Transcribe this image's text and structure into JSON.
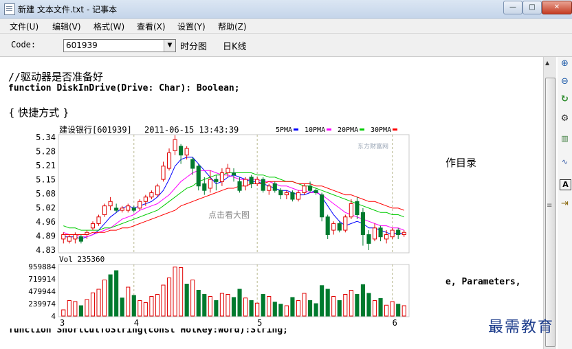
{
  "window": {
    "title": "新建 文本文件.txt - 记事本",
    "minimize": "—",
    "maximize": "□",
    "close": "✕"
  },
  "menu": [
    "文件(U)",
    "编辑(V)",
    "格式(W)",
    "查看(X)",
    "设置(Y)",
    "帮助(Z)"
  ],
  "toolbar": {
    "code_label": "Code:",
    "code_value": "601939",
    "time_chart": "时分图",
    "daily_k": "日K线"
  },
  "editor": {
    "comment": "//驱动器是否准备好",
    "func1": "function DiskInDrive(Drive: Char): Boolean;",
    "section": "{ 快捷方式 }",
    "partial_right": "作目录",
    "params": "e, Parameters,",
    "func2": "function ShortCutToString(const HotKey:Word):String;"
  },
  "right_icons": [
    "zoom-in-icon",
    "zoom-out-icon",
    "refresh-icon",
    "settings-icon",
    "bar-chart-icon",
    "line-chart-icon",
    "text-icon",
    "exit-icon"
  ],
  "watermark": "最需教育",
  "chart_data": {
    "type": "candlestick",
    "title": "建设银行[601939]",
    "timestamp": "2011-06-15 13:43:39",
    "center_label": "点击看大图",
    "source_logo": "东方财富网",
    "legend": [
      {
        "name": "5PMA",
        "color": "#0000ff"
      },
      {
        "name": "10PMA",
        "color": "#ff00ff"
      },
      {
        "name": "20PMA",
        "color": "#00cc00"
      },
      {
        "name": "30PMA",
        "color": "#ff0000"
      }
    ],
    "price_ticks": [
      "5.34",
      "5.28",
      "5.21",
      "5.15",
      "5.08",
      "5.02",
      "4.96",
      "4.89",
      "4.83"
    ],
    "price_range": [
      4.83,
      5.34
    ],
    "volume_label": "Vol 235360",
    "volume_ticks": [
      "959884",
      "719914",
      "479944",
      "239974",
      "4"
    ],
    "volume_max": 959884,
    "x_ticks": [
      "3",
      "4",
      "5",
      "6"
    ],
    "candles": [
      {
        "o": 4.88,
        "c": 4.9,
        "h": 4.91,
        "l": 4.86
      },
      {
        "o": 4.87,
        "c": 4.89,
        "h": 4.9,
        "l": 4.86
      },
      {
        "o": 4.88,
        "c": 4.9,
        "h": 4.91,
        "l": 4.86
      },
      {
        "o": 4.89,
        "c": 4.87,
        "h": 4.9,
        "l": 4.86
      },
      {
        "o": 4.9,
        "c": 4.91,
        "h": 4.92,
        "l": 4.88
      },
      {
        "o": 4.93,
        "c": 4.95,
        "h": 4.96,
        "l": 4.92
      },
      {
        "o": 4.95,
        "c": 4.98,
        "h": 4.99,
        "l": 4.94
      },
      {
        "o": 4.99,
        "c": 5.03,
        "h": 5.04,
        "l": 4.98
      },
      {
        "o": 5.03,
        "c": 5.05,
        "h": 5.07,
        "l": 5.01
      },
      {
        "o": 5.02,
        "c": 5.01,
        "h": 5.04,
        "l": 5.0
      },
      {
        "o": 5.01,
        "c": 5.02,
        "h": 5.03,
        "l": 5.0
      },
      {
        "o": 5.01,
        "c": 5.03,
        "h": 5.04,
        "l": 5.0
      },
      {
        "o": 5.02,
        "c": 5.01,
        "h": 5.03,
        "l": 5.0
      },
      {
        "o": 5.02,
        "c": 5.05,
        "h": 5.06,
        "l": 5.01
      },
      {
        "o": 5.05,
        "c": 5.07,
        "h": 5.08,
        "l": 5.03
      },
      {
        "o": 5.07,
        "c": 5.09,
        "h": 5.1,
        "l": 5.06
      },
      {
        "o": 5.08,
        "c": 5.12,
        "h": 5.13,
        "l": 5.07
      },
      {
        "o": 5.15,
        "c": 5.21,
        "h": 5.23,
        "l": 5.14
      },
      {
        "o": 5.2,
        "c": 5.27,
        "h": 5.29,
        "l": 5.19
      },
      {
        "o": 5.28,
        "c": 5.33,
        "h": 5.35,
        "l": 5.26
      },
      {
        "o": 5.3,
        "c": 5.26,
        "h": 5.31,
        "l": 5.22
      },
      {
        "o": 5.26,
        "c": 5.29,
        "h": 5.3,
        "l": 5.24
      },
      {
        "o": 5.24,
        "c": 5.2,
        "h": 5.25,
        "l": 5.17
      },
      {
        "o": 5.21,
        "c": 5.12,
        "h": 5.22,
        "l": 5.1
      },
      {
        "o": 5.13,
        "c": 5.1,
        "h": 5.16,
        "l": 5.08
      },
      {
        "o": 5.11,
        "c": 5.15,
        "h": 5.19,
        "l": 5.09
      },
      {
        "o": 5.15,
        "c": 5.14,
        "h": 5.17,
        "l": 5.1
      },
      {
        "o": 5.14,
        "c": 5.18,
        "h": 5.2,
        "l": 5.12
      },
      {
        "o": 5.18,
        "c": 5.2,
        "h": 5.22,
        "l": 5.16
      },
      {
        "o": 5.18,
        "c": 5.17,
        "h": 5.2,
        "l": 5.14
      },
      {
        "o": 5.14,
        "c": 5.1,
        "h": 5.16,
        "l": 5.09
      },
      {
        "o": 5.12,
        "c": 5.15,
        "h": 5.16,
        "l": 5.1
      },
      {
        "o": 5.16,
        "c": 5.13,
        "h": 5.17,
        "l": 5.11
      },
      {
        "o": 5.13,
        "c": 5.15,
        "h": 5.16,
        "l": 5.12
      },
      {
        "o": 5.15,
        "c": 5.1,
        "h": 5.16,
        "l": 5.09
      },
      {
        "o": 5.1,
        "c": 5.12,
        "h": 5.13,
        "l": 5.08
      },
      {
        "o": 5.13,
        "c": 5.1,
        "h": 5.14,
        "l": 5.09
      },
      {
        "o": 5.1,
        "c": 5.08,
        "h": 5.11,
        "l": 5.06
      },
      {
        "o": 5.08,
        "c": 5.09,
        "h": 5.1,
        "l": 5.06
      },
      {
        "o": 5.09,
        "c": 5.06,
        "h": 5.1,
        "l": 5.05
      },
      {
        "o": 5.06,
        "c": 5.09,
        "h": 5.1,
        "l": 5.05
      },
      {
        "o": 5.09,
        "c": 5.12,
        "h": 5.13,
        "l": 5.08
      },
      {
        "o": 5.12,
        "c": 5.1,
        "h": 5.14,
        "l": 5.09
      },
      {
        "o": 5.1,
        "c": 5.09,
        "h": 5.11,
        "l": 5.08
      },
      {
        "o": 5.08,
        "c": 4.98,
        "h": 5.09,
        "l": 4.96
      },
      {
        "o": 4.98,
        "c": 4.9,
        "h": 4.99,
        "l": 4.88
      },
      {
        "o": 4.92,
        "c": 4.95,
        "h": 4.96,
        "l": 4.9
      },
      {
        "o": 4.95,
        "c": 4.92,
        "h": 4.96,
        "l": 4.91
      },
      {
        "o": 4.92,
        "c": 4.98,
        "h": 4.99,
        "l": 4.91
      },
      {
        "o": 4.98,
        "c": 5.04,
        "h": 5.06,
        "l": 4.97
      },
      {
        "o": 5.05,
        "c": 4.99,
        "h": 5.07,
        "l": 4.97
      },
      {
        "o": 5.0,
        "c": 4.9,
        "h": 5.02,
        "l": 4.85
      },
      {
        "o": 4.9,
        "c": 4.86,
        "h": 4.92,
        "l": 4.83
      },
      {
        "o": 4.88,
        "c": 4.93,
        "h": 4.95,
        "l": 4.87
      },
      {
        "o": 4.93,
        "c": 4.89,
        "h": 4.94,
        "l": 4.87
      },
      {
        "o": 4.88,
        "c": 4.9,
        "h": 4.92,
        "l": 4.86
      },
      {
        "o": 4.89,
        "c": 4.92,
        "h": 4.93,
        "l": 4.88
      },
      {
        "o": 4.92,
        "c": 4.9,
        "h": 4.93,
        "l": 4.88
      },
      {
        "o": 4.9,
        "c": 4.91,
        "h": 4.92,
        "l": 4.89
      }
    ],
    "volumes": [
      [
        120000,
        "up"
      ],
      [
        300000,
        "up"
      ],
      [
        280000,
        "up"
      ],
      [
        200000,
        "down"
      ],
      [
        320000,
        "up"
      ],
      [
        450000,
        "up"
      ],
      [
        520000,
        "up"
      ],
      [
        700000,
        "up"
      ],
      [
        800000,
        "down"
      ],
      [
        880000,
        "down"
      ],
      [
        350000,
        "down"
      ],
      [
        560000,
        "up"
      ],
      [
        400000,
        "down"
      ],
      [
        300000,
        "up"
      ],
      [
        260000,
        "up"
      ],
      [
        380000,
        "up"
      ],
      [
        420000,
        "up"
      ],
      [
        600000,
        "up"
      ],
      [
        740000,
        "up"
      ],
      [
        950000,
        "up"
      ],
      [
        940000,
        "up"
      ],
      [
        620000,
        "down"
      ],
      [
        700000,
        "up"
      ],
      [
        500000,
        "down"
      ],
      [
        420000,
        "down"
      ],
      [
        380000,
        "up"
      ],
      [
        300000,
        "down"
      ],
      [
        440000,
        "up"
      ],
      [
        420000,
        "up"
      ],
      [
        360000,
        "down"
      ],
      [
        520000,
        "down"
      ],
      [
        350000,
        "up"
      ],
      [
        300000,
        "down"
      ],
      [
        250000,
        "up"
      ],
      [
        420000,
        "down"
      ],
      [
        380000,
        "up"
      ],
      [
        270000,
        "down"
      ],
      [
        230000,
        "down"
      ],
      [
        200000,
        "up"
      ],
      [
        360000,
        "down"
      ],
      [
        300000,
        "up"
      ],
      [
        440000,
        "up"
      ],
      [
        300000,
        "down"
      ],
      [
        240000,
        "down"
      ],
      [
        590000,
        "down"
      ],
      [
        520000,
        "down"
      ],
      [
        380000,
        "up"
      ],
      [
        300000,
        "down"
      ],
      [
        420000,
        "up"
      ],
      [
        500000,
        "up"
      ],
      [
        420000,
        "down"
      ],
      [
        610000,
        "down"
      ],
      [
        440000,
        "down"
      ],
      [
        300000,
        "up"
      ],
      [
        340000,
        "down"
      ],
      [
        210000,
        "up"
      ],
      [
        280000,
        "up"
      ],
      [
        230000,
        "down"
      ],
      [
        200000,
        "up"
      ]
    ],
    "ma": {
      "5PMA": [
        4.89,
        4.89,
        4.89,
        4.88,
        4.89,
        4.9,
        4.92,
        4.95,
        4.98,
        5.0,
        5.02,
        5.03,
        5.02,
        5.03,
        5.04,
        5.05,
        5.07,
        5.1,
        5.15,
        5.21,
        5.24,
        5.25,
        5.25,
        5.22,
        5.19,
        5.16,
        5.13,
        5.14,
        5.16,
        5.17,
        5.16,
        5.15,
        5.14,
        5.14,
        5.13,
        5.12,
        5.11,
        5.1,
        5.1,
        5.09,
        5.08,
        5.08,
        5.09,
        5.1,
        5.07,
        5.03,
        4.99,
        4.96,
        4.94,
        4.95,
        4.96,
        4.95,
        4.93,
        4.93,
        4.92,
        4.91,
        4.9,
        4.91,
        4.9
      ],
      "10PMA": [
        4.91,
        4.9,
        4.9,
        4.89,
        4.89,
        4.9,
        4.91,
        4.92,
        4.93,
        4.95,
        4.97,
        4.98,
        4.99,
        5.01,
        5.02,
        5.03,
        5.04,
        5.06,
        5.08,
        5.11,
        5.14,
        5.16,
        5.18,
        5.19,
        5.19,
        5.19,
        5.18,
        5.17,
        5.17,
        5.16,
        5.15,
        5.15,
        5.15,
        5.15,
        5.14,
        5.14,
        5.13,
        5.12,
        5.12,
        5.11,
        5.1,
        5.1,
        5.09,
        5.09,
        5.08,
        5.06,
        5.04,
        5.02,
        5.0,
        4.99,
        4.98,
        4.97,
        4.96,
        4.95,
        4.94,
        4.94,
        4.93,
        4.93,
        4.92
      ],
      "20PMA": [
        4.94,
        4.93,
        4.93,
        4.92,
        4.92,
        4.92,
        4.92,
        4.93,
        4.93,
        4.94,
        4.95,
        4.96,
        4.97,
        4.98,
        4.99,
        5.0,
        5.01,
        5.03,
        5.05,
        5.07,
        5.09,
        5.11,
        5.12,
        5.14,
        5.15,
        5.16,
        5.17,
        5.17,
        5.18,
        5.18,
        5.18,
        5.18,
        5.18,
        5.17,
        5.17,
        5.16,
        5.16,
        5.15,
        5.14,
        5.14,
        5.13,
        5.12,
        5.12,
        5.11,
        5.1,
        5.09,
        5.08,
        5.07,
        5.06,
        5.05,
        5.04,
        5.03,
        5.02,
        5.01,
        5.0,
        5.0,
        4.99,
        4.99,
        4.98
      ],
      "30PMA": [
        4.9,
        4.9,
        4.9,
        4.9,
        4.9,
        4.91,
        4.91,
        4.91,
        4.92,
        4.92,
        4.93,
        4.93,
        4.94,
        4.95,
        4.96,
        4.97,
        4.98,
        4.99,
        5.0,
        5.01,
        5.03,
        5.04,
        5.05,
        5.06,
        5.07,
        5.08,
        5.09,
        5.1,
        5.11,
        5.11,
        5.12,
        5.12,
        5.13,
        5.13,
        5.13,
        5.14,
        5.14,
        5.14,
        5.14,
        5.14,
        5.13,
        5.13,
        5.13,
        5.12,
        5.12,
        5.11,
        5.1,
        5.09,
        5.08,
        5.08,
        5.07,
        5.06,
        5.05,
        5.05,
        5.04,
        5.03,
        5.02,
        5.02,
        5.01
      ]
    }
  }
}
